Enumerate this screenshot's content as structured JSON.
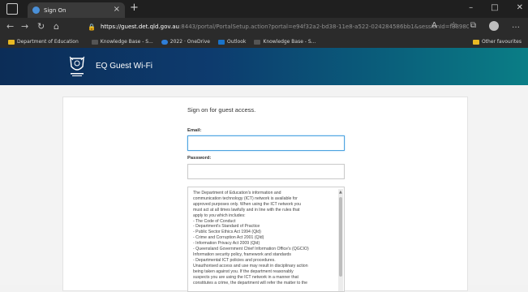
{
  "browser": {
    "tab_title": "Sign On",
    "tab_close": "×",
    "new_tab": "+",
    "url_host": "https://guest.det.qld.gov.au",
    "url_path": ":8443/portal/PortalSetup.action?portal=e94f32a2-bd38-11e8-a522-024284586bb1&sessionId=f38980...",
    "controls": {
      "minimize": "–",
      "maximize": "□",
      "close": "✕"
    },
    "bookmarks": [
      {
        "label": "Department of Education",
        "icon": "folder-icon"
      },
      {
        "label": "Knowledge Base - S...",
        "icon": "kb-icon"
      },
      {
        "label": "2022 · OneDrive",
        "icon": "onedrive-icon"
      },
      {
        "label": "Outlook",
        "icon": "outlook-icon"
      },
      {
        "label": "Knowledge Base - S...",
        "icon": "kb-icon"
      }
    ],
    "other_favourites": "Other favourites"
  },
  "portal": {
    "title": "EQ Guest Wi-Fi"
  },
  "form": {
    "heading": "Sign on for guest access.",
    "email_label": "Email:",
    "password_label": "Password:"
  },
  "terms": {
    "lines": [
      "The Department of Education's information and",
      "communication technology (ICT) network is available for",
      "approved purposes only. When using the ICT network you",
      "must act at all times lawfully and in line with the rules that",
      "apply to you which includes:",
      "- The Code of Conduct",
      "- Department's Standard of Practice",
      "- Public Sector Ethics Act 1994 (Qld)",
      "- Crime and Corruption Act 2001 (Qld)",
      "- Information Privacy Act 2009 (Qld)",
      "- Queensland Government Chief Information Office's (QGCIO)",
      "Information security policy, framework and standards",
      "- Departmental ICT policies and procedures.",
      "Unauthorised access and use may result in disciplinary action",
      "being taken against you. If the department reasonably",
      "suspects you are using the ICT network in a manner that",
      "constitutes a crime, the department will refer the matter to the"
    ]
  }
}
